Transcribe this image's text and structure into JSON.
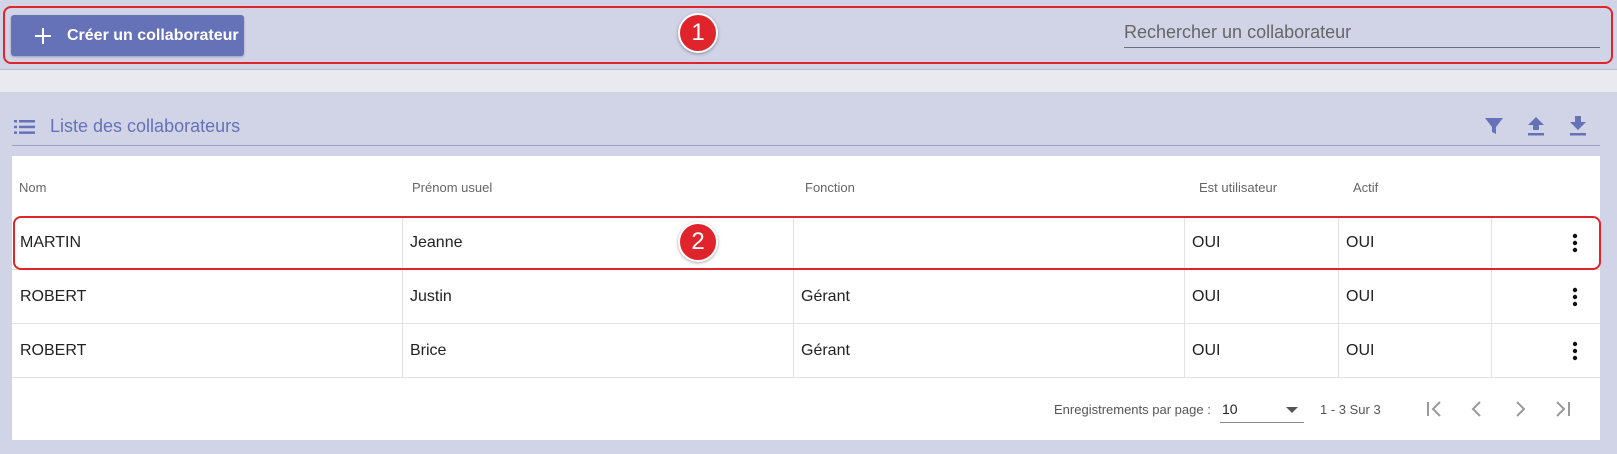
{
  "toolbar": {
    "create_label": "Créer un collaborateur",
    "search_placeholder": "Rechercher un collaborateur"
  },
  "annotations": {
    "badge1": "1",
    "badge2": "2"
  },
  "section": {
    "title": "Liste des collaborateurs"
  },
  "table": {
    "columns": [
      "Nom",
      "Prénom usuel",
      "Fonction",
      "Est utilisateur",
      "Actif"
    ],
    "rows": [
      {
        "nom": "MARTIN",
        "prenom": "Jeanne",
        "fonction": "",
        "est_utilisateur": "OUI",
        "actif": "OUI"
      },
      {
        "nom": "ROBERT",
        "prenom": "Justin",
        "fonction": "Gérant",
        "est_utilisateur": "OUI",
        "actif": "OUI"
      },
      {
        "nom": "ROBERT",
        "prenom": "Brice",
        "fonction": "Gérant",
        "est_utilisateur": "OUI",
        "actif": "OUI"
      }
    ]
  },
  "paginator": {
    "per_page_label": "Enregistrements par page :",
    "per_page_value": "10",
    "range_label": "1 - 3 Sur 3"
  },
  "colors": {
    "accent": "#6672b8",
    "annotation": "#e0242b",
    "background": "#d0d4e6"
  },
  "icons": [
    "plus-icon",
    "list-icon",
    "filter-icon",
    "upload-icon",
    "download-icon",
    "more-vert-icon",
    "first-page-icon",
    "prev-page-icon",
    "next-page-icon",
    "last-page-icon",
    "chevron-down-icon"
  ]
}
